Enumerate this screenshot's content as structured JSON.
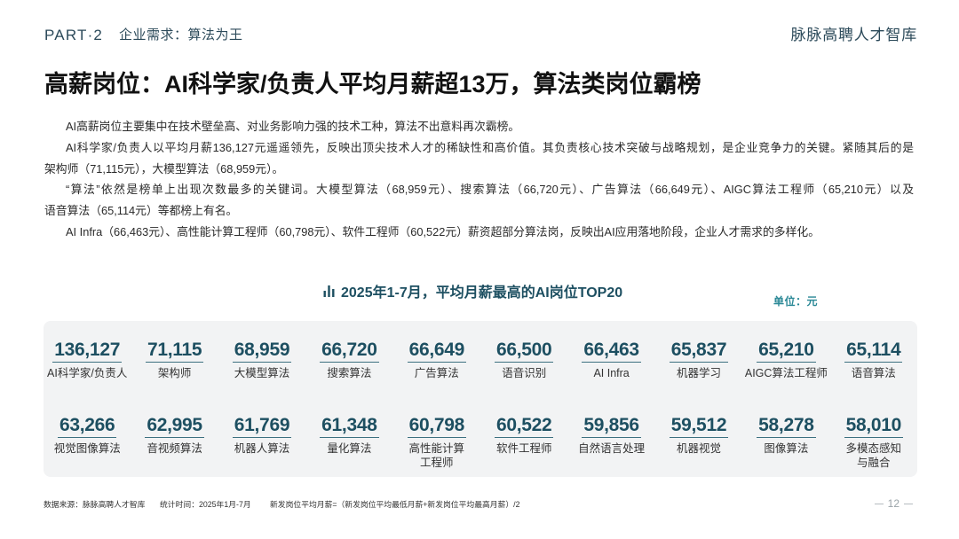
{
  "header": {
    "part": "PART·2",
    "section": "企业需求：算法为王",
    "brand": "脉脉高聘人才智库"
  },
  "title": "高薪岗位：AI科学家/负责人平均月薪超13万，算法类岗位霸榜",
  "paragraphs": [
    [
      "AI高薪岗位主要集中在技术壁垒高、对业务影响力强的技术工种，算法不出意料再次霸榜。"
    ],
    [
      "AI科学家/负责人以平均月薪136,127元遥遥领先，反映出顶尖技术人才的稀缺性和高价值。其负责核心技术突破与战略规划，是企业竞争力的关键。紧随其后的是",
      "架构师（71,115元），大模型算法（68,959元）。"
    ],
    [
      "“算法”依然是榜单上出现次数最多的关键词。大模型算法（68,959元）、搜索算法（66,720元）、广告算法（66,649元）、AIGC算法工程师（65,210元）以及",
      "语音算法（65,114元）等都榜上有名。"
    ],
    [
      "AI Infra（66,463元）、高性能计算工程师（60,798元）、软件工程师（60,522元）薪资超部分算法岗，反映出AI应用落地阶段，企业人才需求的多样化。"
    ]
  ],
  "ranking": {
    "icon": "bar-chart-icon",
    "title": "2025年1-7月，平均月薪最高的AI岗位TOP20",
    "unit": "单位：元",
    "items": [
      {
        "value": "136,127",
        "label": "AI科学家/负责人"
      },
      {
        "value": "71,115",
        "label": "架构师"
      },
      {
        "value": "68,959",
        "label": "大模型算法"
      },
      {
        "value": "66,720",
        "label": "搜索算法"
      },
      {
        "value": "66,649",
        "label": "广告算法"
      },
      {
        "value": "66,500",
        "label": "语音识别"
      },
      {
        "value": "66,463",
        "label": "AI Infra"
      },
      {
        "value": "65,837",
        "label": "机器学习"
      },
      {
        "value": "65,210",
        "label": "AIGC算法工程师"
      },
      {
        "value": "65,114",
        "label": "语音算法"
      },
      {
        "value": "63,266",
        "label": "视觉图像算法"
      },
      {
        "value": "62,995",
        "label": "音视频算法"
      },
      {
        "value": "61,769",
        "label": "机器人算法"
      },
      {
        "value": "61,348",
        "label": "量化算法"
      },
      {
        "value": "60,798",
        "label": "高性能计算\n工程师"
      },
      {
        "value": "60,522",
        "label": "软件工程师"
      },
      {
        "value": "59,856",
        "label": "自然语言处理"
      },
      {
        "value": "59,512",
        "label": "机器视觉"
      },
      {
        "value": "58,278",
        "label": "图像算法"
      },
      {
        "value": "58,010",
        "label": "多模态感知\n与融合"
      }
    ]
  },
  "footer": {
    "source": "数据来源：脉脉高聘人才智库",
    "period": "统计时间：2025年1月-7月",
    "note": "新发岗位平均月薪=（新发岗位平均最低月薪+新发岗位平均最高月薪）/2",
    "page": "12"
  },
  "colors": {
    "header": "#2c4a5a",
    "accent": "#1d4f61",
    "unit": "#2a8896",
    "underline": "#3c7080",
    "panel": "#f2f3f4"
  }
}
